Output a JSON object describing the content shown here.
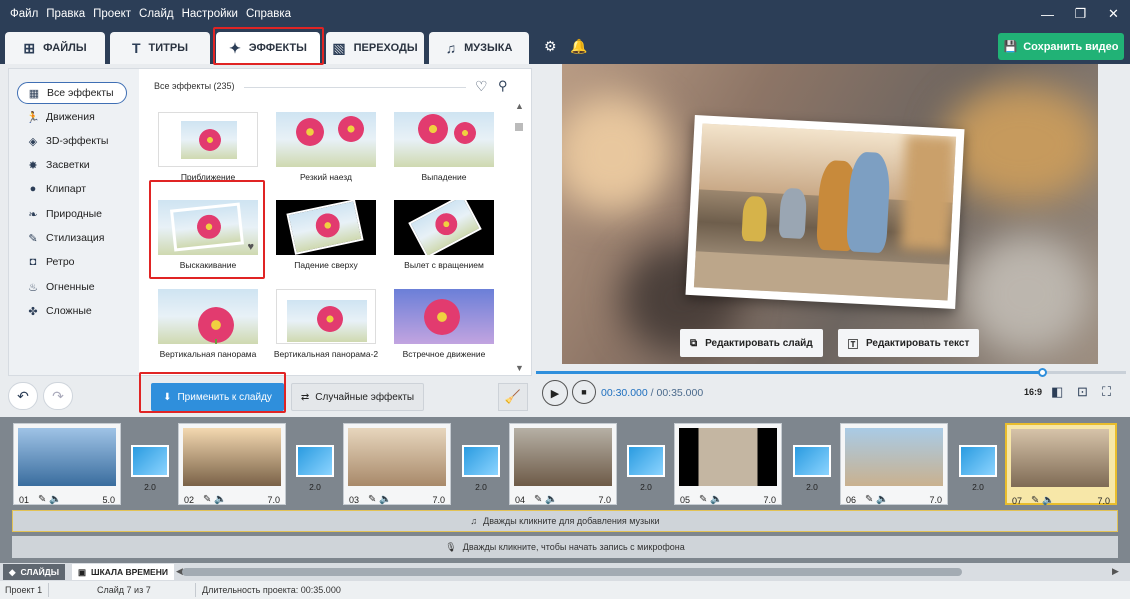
{
  "menu": [
    "Файл",
    "Правка",
    "Проект",
    "Слайд",
    "Настройки",
    "Справка"
  ],
  "window_controls": {
    "minimize": "—",
    "maximize": "❐",
    "close": "✕"
  },
  "tabs": [
    {
      "label": "ФАЙЛЫ",
      "icon": "add-file-icon"
    },
    {
      "label": "ТИТРЫ",
      "icon": "text-icon"
    },
    {
      "label": "ЭФФЕКТЫ",
      "icon": "star-effects-icon",
      "active": true
    },
    {
      "label": "ПЕРЕХОДЫ",
      "icon": "transition-icon"
    },
    {
      "label": "МУЗЫКА",
      "icon": "music-icon"
    }
  ],
  "save_label": "Сохранить видео",
  "sidebar": {
    "items": [
      {
        "label": "Все эффекты",
        "icon": "grid-icon",
        "active": true
      },
      {
        "label": "Движения",
        "icon": "running-icon"
      },
      {
        "label": "3D-эффекты",
        "icon": "cube-icon"
      },
      {
        "label": "Засветки",
        "icon": "sparkle-icon"
      },
      {
        "label": "Клипарт",
        "icon": "pin-icon"
      },
      {
        "label": "Природные",
        "icon": "leaf-icon"
      },
      {
        "label": "Стилизация",
        "icon": "brush-icon"
      },
      {
        "label": "Ретро",
        "icon": "camera-icon"
      },
      {
        "label": "Огненные",
        "icon": "fire-icon"
      },
      {
        "label": "Сложные",
        "icon": "puzzle-icon"
      }
    ]
  },
  "effects_header": "Все эффекты (235)",
  "effects": [
    {
      "label": "Приближение"
    },
    {
      "label": "Резкий наезд"
    },
    {
      "label": "Выпадение"
    },
    {
      "label": "Выскакивание"
    },
    {
      "label": "Падение сверху"
    },
    {
      "label": "Вылет с вращением"
    },
    {
      "label": "Вертикальная панорама"
    },
    {
      "label": "Вертикальная панорама-2"
    },
    {
      "label": "Встречное движение"
    }
  ],
  "apply_label": "Применить к слайду",
  "random_label": "Случайные эффекты",
  "edit_slide_label": "Редактировать слайд",
  "edit_text_label": "Редактировать текст",
  "playback": {
    "current": "00:30.000",
    "separator": " / ",
    "total": "00:35.000",
    "progress": 0.857,
    "ratio": "16:9"
  },
  "slides": [
    {
      "num": "01",
      "dur": "5.0"
    },
    {
      "num": "02",
      "dur": "7.0"
    },
    {
      "num": "03",
      "dur": "7.0"
    },
    {
      "num": "04",
      "dur": "7.0"
    },
    {
      "num": "05",
      "dur": "7.0"
    },
    {
      "num": "06",
      "dur": "7.0"
    },
    {
      "num": "07",
      "dur": "7.0",
      "active": true
    }
  ],
  "transitions": [
    "2.0",
    "2.0",
    "2.0",
    "2.0",
    "2.0",
    "2.0"
  ],
  "music_hint": "Дважды кликните для добавления музыки",
  "mic_hint": "Дважды кликните, чтобы начать запись с микрофона",
  "bottom_tabs": {
    "slides": "СЛАЙДЫ",
    "timeline": "ШКАЛА ВРЕМЕНИ"
  },
  "status": {
    "project": "Проект 1",
    "slide": "Слайд 7 из 7",
    "duration": "Длительность проекта: 00:35.000"
  }
}
